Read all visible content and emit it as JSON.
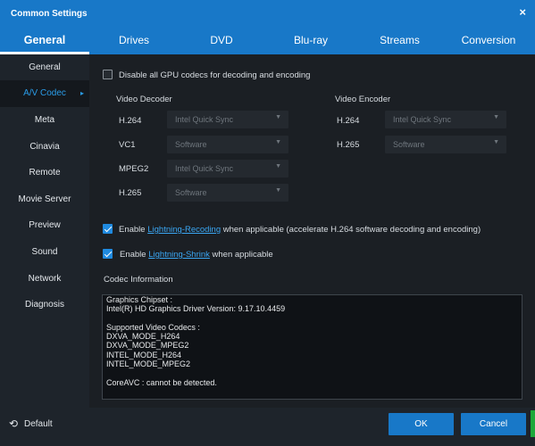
{
  "window": {
    "title": "Common Settings",
    "close_glyph": "×"
  },
  "tabs": [
    {
      "label": "General",
      "active": true
    },
    {
      "label": "Drives"
    },
    {
      "label": "DVD"
    },
    {
      "label": "Blu-ray"
    },
    {
      "label": "Streams"
    },
    {
      "label": "Conversion"
    }
  ],
  "sidebar": {
    "items": [
      {
        "label": "General"
      },
      {
        "label": "A/V Codec",
        "active": true
      },
      {
        "label": "Meta"
      },
      {
        "label": "Cinavia"
      },
      {
        "label": "Remote"
      },
      {
        "label": "Movie Server"
      },
      {
        "label": "Preview"
      },
      {
        "label": "Sound"
      },
      {
        "label": "Network"
      },
      {
        "label": "Diagnosis"
      }
    ],
    "active_chevron": "▸"
  },
  "gpu_disable": {
    "label": "Disable all GPU codecs for decoding and encoding",
    "checked": false
  },
  "decoder": {
    "heading": "Video Decoder",
    "rows": [
      {
        "codec": "H.264",
        "value": "Intel Quick Sync"
      },
      {
        "codec": "VC1",
        "value": "Software"
      },
      {
        "codec": "MPEG2",
        "value": "Intel Quick Sync"
      },
      {
        "codec": "H.265",
        "value": "Software"
      }
    ]
  },
  "encoder": {
    "heading": "Video Encoder",
    "rows": [
      {
        "codec": "H.264",
        "value": "Intel Quick Sync"
      },
      {
        "codec": "H.265",
        "value": "Software"
      }
    ]
  },
  "dropdown_arrow": "▼",
  "lightning_recoding": {
    "checked": true,
    "prefix": "Enable ",
    "link": "Lightning-Recoding",
    "suffix": " when applicable (accelerate H.264 software decoding and encoding)"
  },
  "lightning_shrink": {
    "checked": true,
    "prefix": "Enable ",
    "link": "Lightning-Shrink",
    "suffix": " when applicable"
  },
  "codec_info": {
    "heading": "Codec Information",
    "lines": [
      "Graphics Chipset :",
      "Intel(R) HD Graphics Driver Version: 9.17.10.4459",
      "",
      "Supported Video Codecs :",
      "DXVA_MODE_H264",
      "DXVA_MODE_MPEG2",
      "INTEL_MODE_H264",
      "INTEL_MODE_MPEG2",
      "",
      "CoreAVC : cannot be detected."
    ]
  },
  "footer": {
    "default_icon": "⟲",
    "default_label": "Default",
    "ok_label": "OK",
    "cancel_label": "Cancel"
  },
  "colors": {
    "accent": "#1878c8",
    "link": "#3aa6f2",
    "active_sidebar_text": "#2a9ce8",
    "background": "#1b1f24"
  }
}
